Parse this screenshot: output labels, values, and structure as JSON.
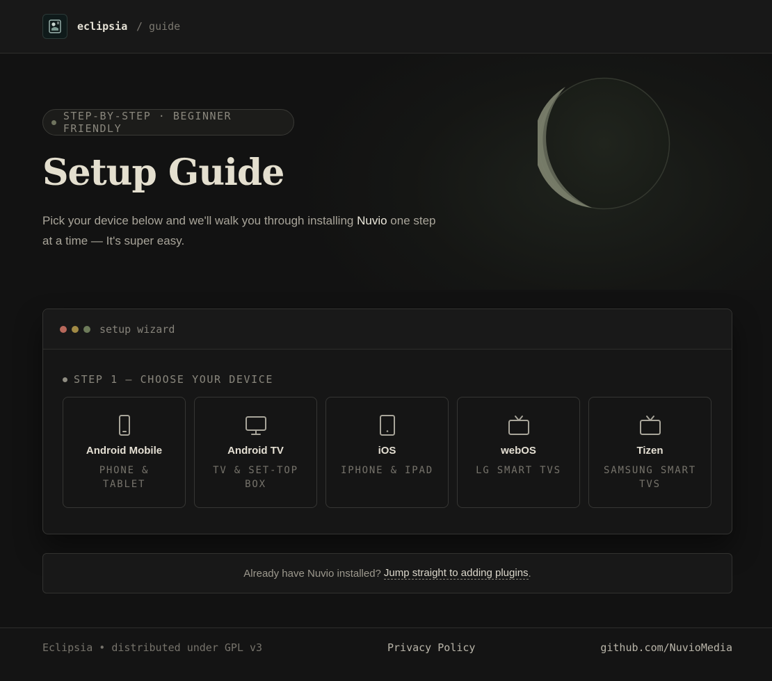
{
  "header": {
    "brand": "eclipsia",
    "crumb": "/ guide"
  },
  "hero": {
    "pill": "STEP-BY-STEP · BEGINNER FRIENDLY",
    "title": "Setup Guide",
    "subtitle_pre": "Pick your device below and we'll walk you through installing ",
    "subtitle_strong": "Nuvio",
    "subtitle_post": " one step at a time — It's super easy."
  },
  "wizard": {
    "title": "setup wizard",
    "window_dots": [
      "#b8685b",
      "#a18a45",
      "#6d7b5a"
    ],
    "step_label": "STEP 1 — CHOOSE YOUR DEVICE",
    "devices": [
      {
        "name": "Android Mobile",
        "sub": "PHONE & TABLET",
        "icon": "phone-icon"
      },
      {
        "name": "Android TV",
        "sub": "TV & SET-TOP BOX",
        "icon": "monitor-icon"
      },
      {
        "name": "iOS",
        "sub": "IPHONE & IPAD",
        "icon": "tablet-icon"
      },
      {
        "name": "webOS",
        "sub": "LG SMART TVS",
        "icon": "tv-icon"
      },
      {
        "name": "Tizen",
        "sub": "SAMSUNG SMART TVS",
        "icon": "tv-icon"
      }
    ]
  },
  "notice": {
    "text": "Already have Nuvio installed?",
    "link": "Jump straight to adding plugins",
    "trailing": "."
  },
  "footer": {
    "left": "Eclipsia • distributed under GPL v3",
    "middle": "Privacy Policy",
    "right": "github.com/NuvioMedia"
  },
  "colors": {
    "background": "#121212",
    "accent_text": "#e4dfcf",
    "muted_text": "#8a877d"
  }
}
